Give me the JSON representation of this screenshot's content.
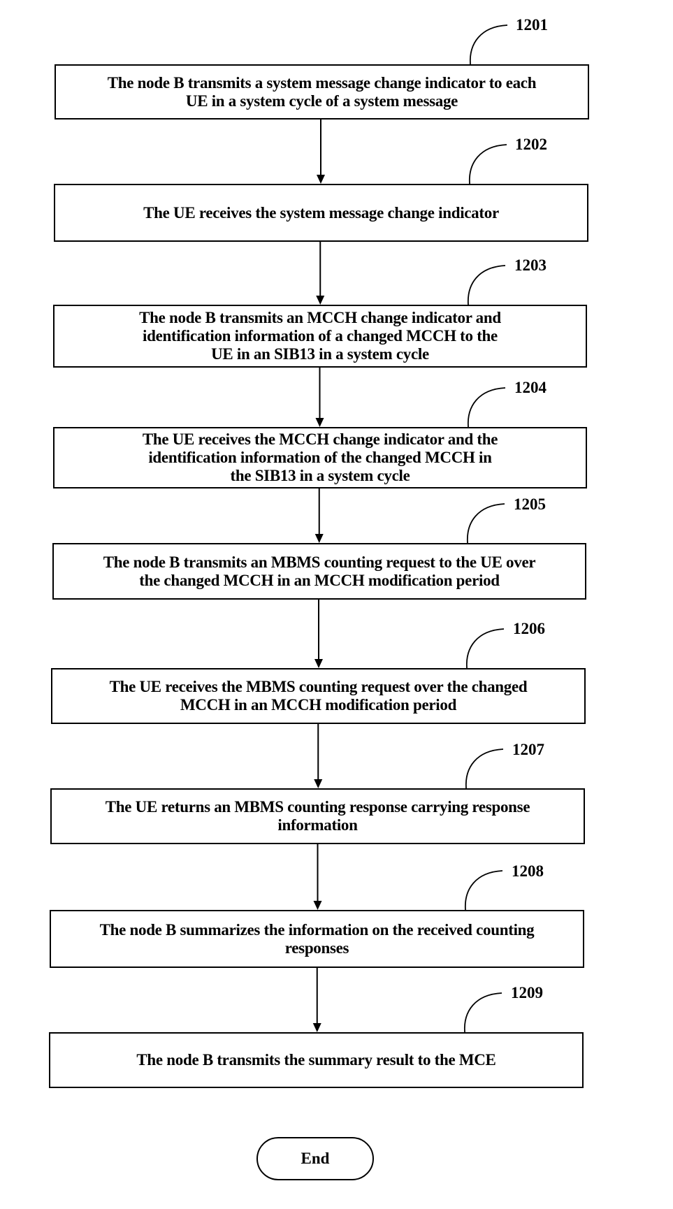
{
  "figure": {
    "steps": [
      {
        "id": "1201",
        "text": "The node B transmits a system message change indicator to each\nUE in a system cycle of a system message"
      },
      {
        "id": "1202",
        "text": "The UE receives the system message change indicator"
      },
      {
        "id": "1203",
        "text": "The node B transmits an MCCH change indicator and\nidentification information of a changed MCCH to the\nUE in an SIB13 in a system cycle"
      },
      {
        "id": "1204",
        "text": "The UE receives the MCCH change indicator and the\nidentification information of the changed MCCH in\nthe SIB13 in a system cycle"
      },
      {
        "id": "1205",
        "text": "The node B transmits an MBMS counting request to the UE over\nthe changed MCCH in an MCCH modification period"
      },
      {
        "id": "1206",
        "text": "The UE receives the MBMS counting request over the changed\nMCCH in an MCCH modification period"
      },
      {
        "id": "1207",
        "text": "The UE returns an MBMS counting response carrying response\ninformation"
      },
      {
        "id": "1208",
        "text": "The node B summarizes the information on the received counting\nresponses"
      },
      {
        "id": "1209",
        "text": "The node B transmits the summary result to the MCE"
      }
    ],
    "end_label": "End"
  }
}
